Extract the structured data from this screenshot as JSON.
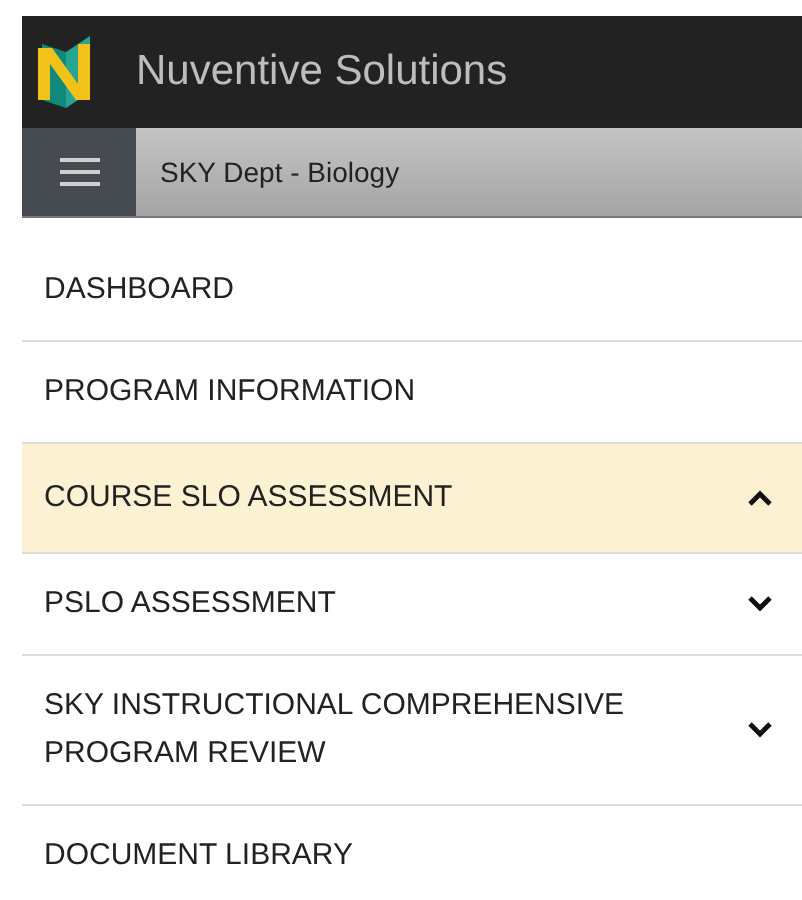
{
  "header": {
    "title": "Nuventive Solutions"
  },
  "subbar": {
    "title": "SKY Dept - Biology"
  },
  "menu": [
    {
      "label": "DASHBOARD",
      "kind": "link",
      "selected": false
    },
    {
      "label": "PROGRAM INFORMATION",
      "kind": "link",
      "selected": false
    },
    {
      "label": "COURSE SLO ASSESSMENT",
      "kind": "expandable",
      "expanded": true,
      "selected": true
    },
    {
      "label": "PSLO ASSESSMENT",
      "kind": "expandable",
      "expanded": false,
      "selected": false
    },
    {
      "label": "SKY INSTRUCTIONAL COMPREHENSIVE PROGRAM REVIEW",
      "kind": "expandable",
      "expanded": false,
      "selected": false
    },
    {
      "label": "DOCUMENT LIBRARY",
      "kind": "link",
      "selected": false
    }
  ]
}
